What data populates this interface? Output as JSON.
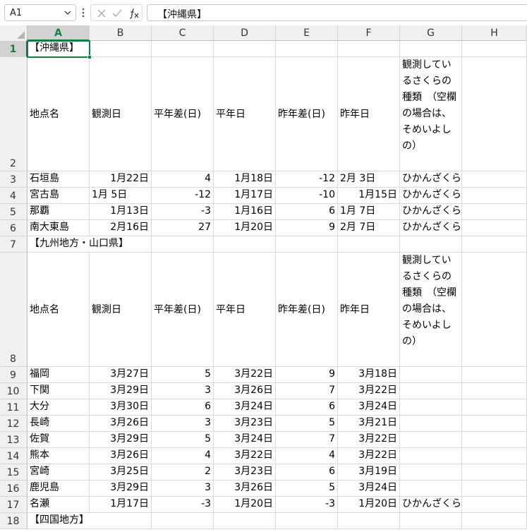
{
  "formula_bar": {
    "name_box": "A1",
    "formula": "【沖縄県】"
  },
  "icons": {
    "name_box_dropdown": "chevron-down-icon",
    "more": "vertical-dots-icon",
    "cancel": "close-icon",
    "confirm": "check-icon",
    "function": "fx-icon",
    "select_all": "select-all-triangle-icon"
  },
  "colors": {
    "accent": "#107c41",
    "header_bg": "#f0f0f0",
    "header_selected_bg": "#d2d2d2",
    "gridline": "#dadada"
  },
  "columns": [
    "A",
    "B",
    "C",
    "D",
    "E",
    "F",
    "G",
    "H"
  ],
  "rows": [
    "1",
    "2",
    "3",
    "4",
    "5",
    "6",
    "7",
    "8",
    "9",
    "10",
    "11",
    "12",
    "13",
    "14",
    "15",
    "16",
    "17",
    "18"
  ],
  "cells": {
    "r1": {
      "a": "【沖縄県】"
    },
    "r2": {
      "a": "地点名",
      "b": "観測日",
      "c": "平年差(日)",
      "d": "平年日",
      "e": "昨年差(日)",
      "f": "昨年日",
      "g": "観測しているさくらの種類　（空欄の場合は、そめいよしの）"
    },
    "r3": {
      "a": "石垣島",
      "b": "1月22日",
      "c": "4",
      "d": "1月18日",
      "e": "-12",
      "f": "2月 3日",
      "g": "ひかんざくら"
    },
    "r4": {
      "a": "宮古島",
      "b": "1月 5日",
      "c": "-12",
      "d": "1月17日",
      "e": "-10",
      "f": "1月15日",
      "g": "ひかんざくら"
    },
    "r5": {
      "a": "那覇",
      "b": "1月13日",
      "c": "-3",
      "d": "1月16日",
      "e": "6",
      "f": "1月 7日",
      "g": "ひかんざくら"
    },
    "r6": {
      "a": "南大東島",
      "b": "2月16日",
      "c": "27",
      "d": "1月20日",
      "e": "9",
      "f": "2月 7日",
      "g": "ひかんざくら"
    },
    "r7": {
      "a": "【九州地方・山口県】"
    },
    "r8": {
      "a": "地点名",
      "b": "観測日",
      "c": "平年差(日)",
      "d": "平年日",
      "e": "昨年差(日)",
      "f": "昨年日",
      "g": "観測しているさくらの種類　（空欄の場合は、そめいよしの）"
    },
    "r9": {
      "a": "福岡",
      "b": "3月27日",
      "c": "5",
      "d": "3月22日",
      "e": "9",
      "f": "3月18日"
    },
    "r10": {
      "a": "下関",
      "b": "3月29日",
      "c": "3",
      "d": "3月26日",
      "e": "7",
      "f": "3月22日"
    },
    "r11": {
      "a": "大分",
      "b": "3月30日",
      "c": "6",
      "d": "3月24日",
      "e": "6",
      "f": "3月24日"
    },
    "r12": {
      "a": "長崎",
      "b": "3月26日",
      "c": "3",
      "d": "3月23日",
      "e": "5",
      "f": "3月21日"
    },
    "r13": {
      "a": "佐賀",
      "b": "3月29日",
      "c": "5",
      "d": "3月24日",
      "e": "7",
      "f": "3月22日"
    },
    "r14": {
      "a": "熊本",
      "b": "3月26日",
      "c": "4",
      "d": "3月22日",
      "e": "4",
      "f": "3月22日"
    },
    "r15": {
      "a": "宮崎",
      "b": "3月25日",
      "c": "2",
      "d": "3月23日",
      "e": "6",
      "f": "3月19日"
    },
    "r16": {
      "a": "鹿児島",
      "b": "3月29日",
      "c": "3",
      "d": "3月26日",
      "e": "5",
      "f": "3月24日"
    },
    "r17": {
      "a": "名瀬",
      "b": "1月17日",
      "c": "-3",
      "d": "1月20日",
      "e": "-3",
      "f": "1月20日",
      "g": "ひかんざくら"
    },
    "r18": {
      "a": "【四国地方】"
    }
  }
}
